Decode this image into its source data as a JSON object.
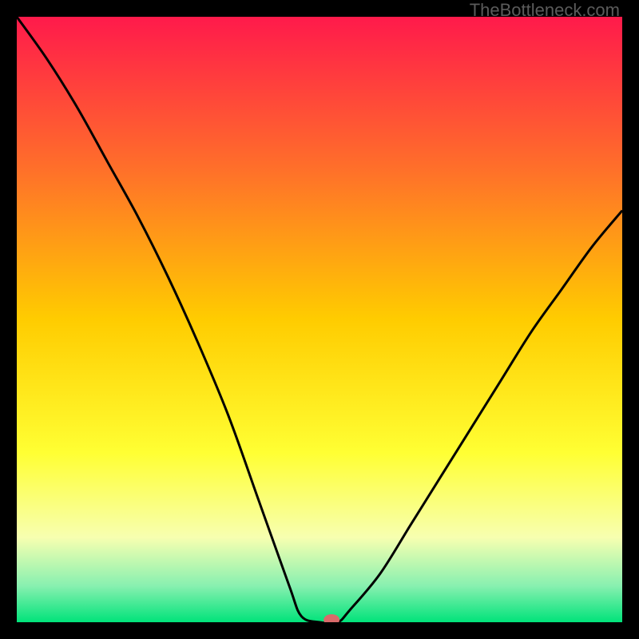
{
  "watermark": "TheBottleneck.com",
  "chart_data": {
    "type": "line",
    "title": "",
    "xlabel": "",
    "ylabel": "",
    "xlim": [
      0,
      100
    ],
    "ylim": [
      0,
      100
    ],
    "x": [
      0,
      5,
      10,
      15,
      20,
      25,
      30,
      35,
      40,
      45,
      47,
      50,
      53,
      55,
      60,
      65,
      70,
      75,
      80,
      85,
      90,
      95,
      100
    ],
    "values": [
      100,
      93,
      85,
      76,
      67,
      57,
      46,
      34,
      20,
      6,
      1,
      0,
      0,
      2,
      8,
      16,
      24,
      32,
      40,
      48,
      55,
      62,
      68
    ],
    "marker": {
      "x": 52,
      "y": 0,
      "color": "#d96a6a"
    },
    "background_gradient": {
      "stops": [
        {
          "pos": 0.0,
          "color": "#ff1a4b"
        },
        {
          "pos": 0.25,
          "color": "#ff6f2a"
        },
        {
          "pos": 0.5,
          "color": "#ffcc00"
        },
        {
          "pos": 0.72,
          "color": "#ffff33"
        },
        {
          "pos": 0.86,
          "color": "#f7ffb0"
        },
        {
          "pos": 0.94,
          "color": "#88f0b0"
        },
        {
          "pos": 1.0,
          "color": "#00e37a"
        }
      ]
    }
  }
}
